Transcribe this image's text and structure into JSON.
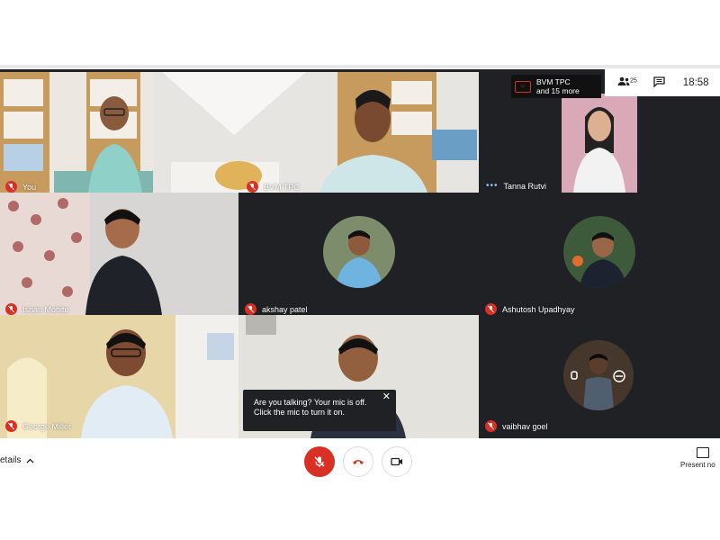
{
  "meeting": {
    "participant_count": "25",
    "clock": "18:58",
    "presentation": {
      "name": "BVM TPC",
      "more": "and 15 more"
    }
  },
  "tiles": [
    {
      "name": "You"
    },
    {
      "name": "BVM TPC"
    },
    {
      "name": "Tanna Rutvi"
    },
    {
      "name": "Ishan Mohite"
    },
    {
      "name": "akshay patel"
    },
    {
      "name": "Ashutosh Upadhyay"
    },
    {
      "name": "George Miller"
    },
    {
      "name": ""
    },
    {
      "name": "vaibhav goel"
    }
  ],
  "tooltip": {
    "text": "Are you talking? Your mic is off. Click the mic to turn it on."
  },
  "controls": {
    "details_label": "etails",
    "present_label": "Present no"
  },
  "colors": {
    "accent_red": "#d93025",
    "tile_bg": "#3c4043",
    "grid_bg": "#202124"
  },
  "icons": [
    "people-icon",
    "chat-icon",
    "mic-off-icon",
    "hangup-icon",
    "camera-icon",
    "present-icon",
    "chevron-up-icon",
    "close-icon"
  ]
}
